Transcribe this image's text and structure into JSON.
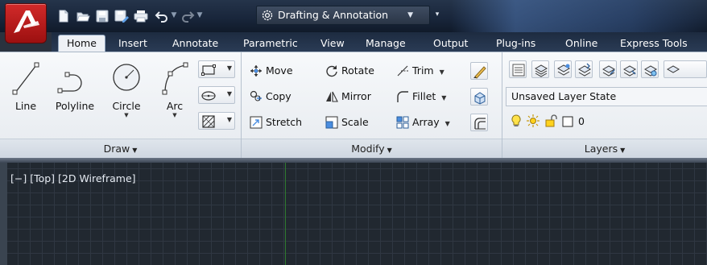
{
  "workspace": {
    "name": "Drafting & Annotation",
    "icon": "gear-icon"
  },
  "quick_access": [
    "new-icon",
    "open-icon",
    "save-icon",
    "save-as-icon",
    "plot-icon",
    "undo-icon",
    "redo-icon"
  ],
  "tabs": [
    "Home",
    "Insert",
    "Annotate",
    "Parametric",
    "View",
    "Manage",
    "Output",
    "Plug-ins",
    "Online",
    "Express Tools"
  ],
  "active_tab": "Home",
  "draw_panel": {
    "title": "Draw",
    "tools": [
      "Line",
      "Polyline",
      "Circle",
      "Arc"
    ]
  },
  "modify_panel": {
    "title": "Modify",
    "rows": [
      [
        "Move",
        "Rotate",
        "Trim"
      ],
      [
        "Copy",
        "Mirror",
        "Fillet"
      ],
      [
        "Stretch",
        "Scale",
        "Array"
      ]
    ]
  },
  "layers_panel": {
    "title": "Layers",
    "layer_state": "Unsaved Layer State",
    "current_layer": "0"
  },
  "viewport_label": "[−] [Top] [2D Wireframe]",
  "colors": {
    "title_bar": "#18253a",
    "logo_red": "#c21d1d",
    "ribbon_bg": "#eef1f5",
    "drawing_bg": "#212830",
    "grid_line": "#2f3742",
    "ucs_y_axis": "#2f7a2f"
  }
}
